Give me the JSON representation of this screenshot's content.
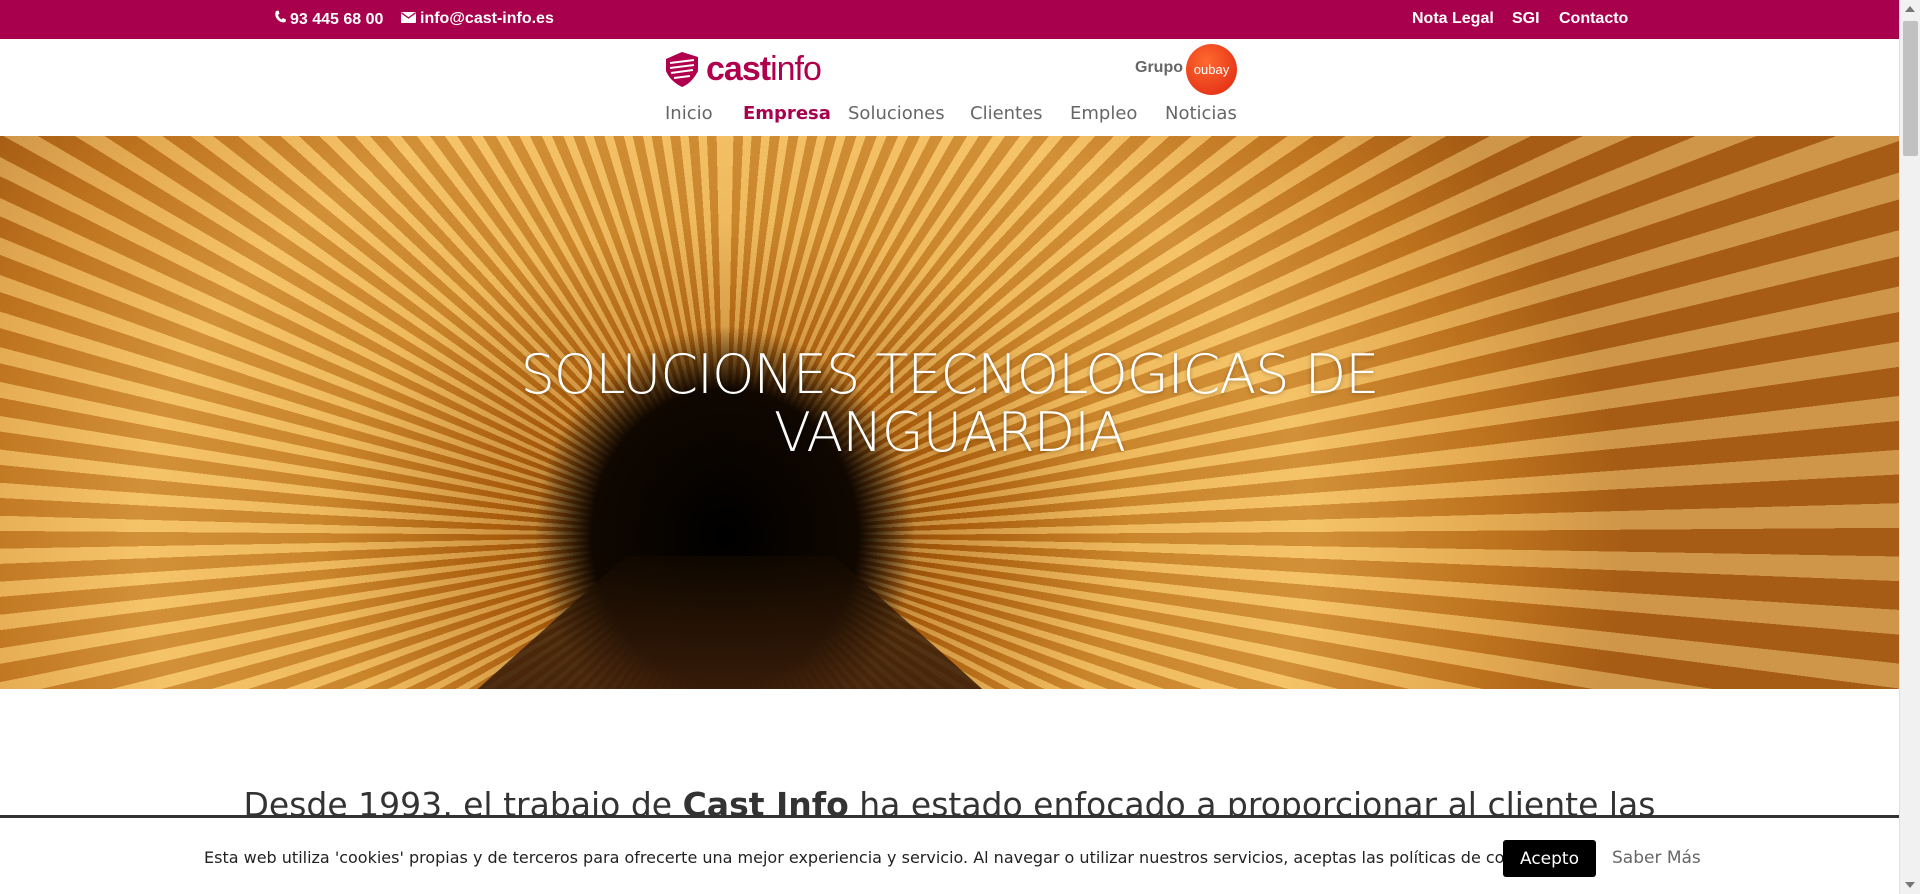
{
  "topbar": {
    "phone": "93 445 68 00",
    "email": "info@cast-info.es",
    "links": [
      "Nota Legal",
      "SGI",
      "Contacto"
    ]
  },
  "header": {
    "logo_bold": "cast",
    "logo_regular": "info",
    "grupo_label": "Grupo",
    "grupo_badge": "oubay"
  },
  "nav": {
    "items": [
      "Inicio",
      "Empresa",
      "Soluciones",
      "Clientes",
      "Empleo",
      "Noticias"
    ],
    "active": "Empresa"
  },
  "hero": {
    "line1": "SOLUCIONES TECNOLOGICAS DE",
    "line2": "VANGUARDIA"
  },
  "intro": {
    "prefix": "Desde 1993, el trabajo de ",
    "brand": "Cast Info",
    "suffix": " ha estado enfocado a proporcionar al cliente las"
  },
  "cookie": {
    "text": "Esta web utiliza 'cookies' propias y de terceros para ofrecerte una mejor experiencia y servicio. Al navegar o utilizar nuestros servicios, aceptas las políticas de cookies",
    "accept": "Acepto",
    "more": "Saber Más"
  },
  "colors": {
    "brand": "#a8004c",
    "grupo": "#e8391b"
  }
}
